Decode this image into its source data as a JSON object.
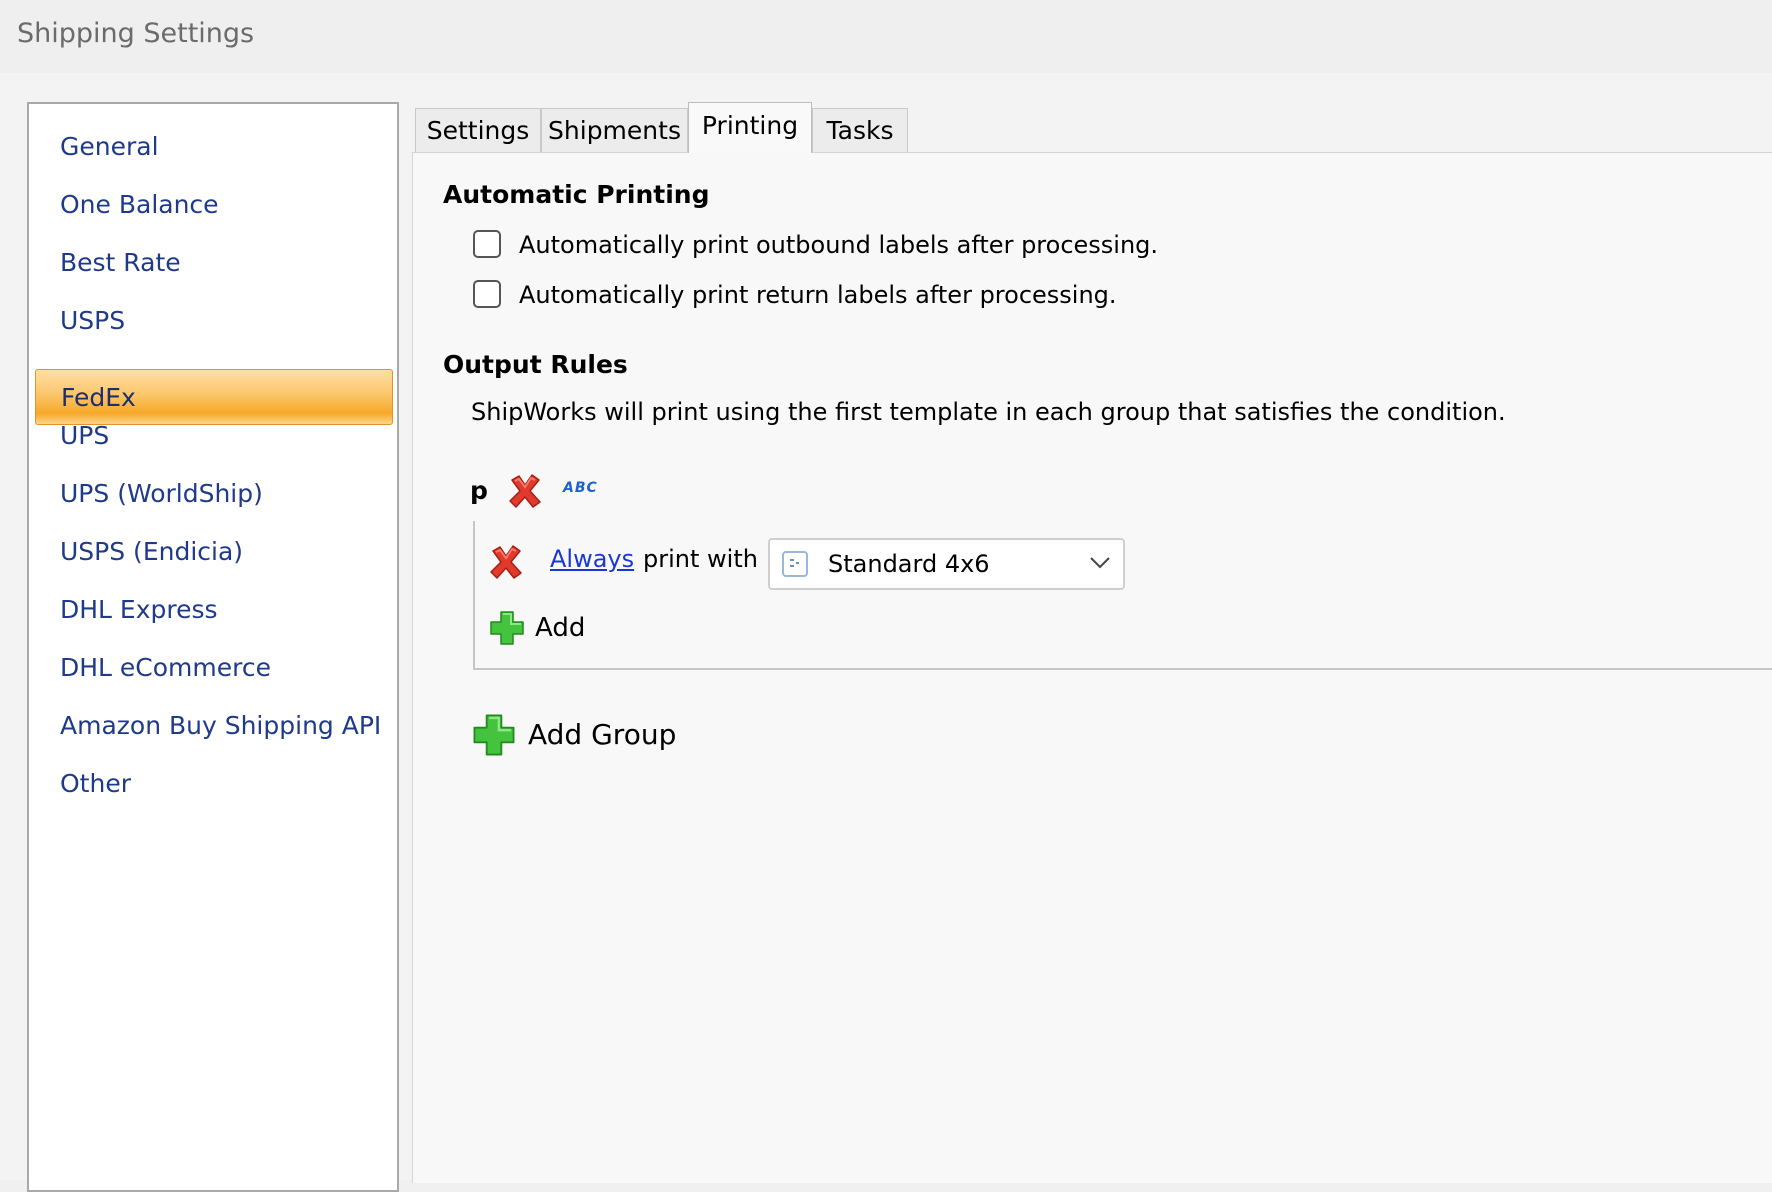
{
  "window": {
    "title": "Shipping Settings"
  },
  "sidebar": {
    "items": [
      {
        "label": "General"
      },
      {
        "label": "One Balance"
      },
      {
        "label": "Best Rate"
      },
      {
        "label": "USPS"
      },
      {
        "label": "FedEx"
      },
      {
        "label": "UPS"
      },
      {
        "label": "UPS (WorldShip)"
      },
      {
        "label": "USPS (Endicia)"
      },
      {
        "label": "DHL Express"
      },
      {
        "label": "DHL eCommerce"
      },
      {
        "label": "Amazon Buy Shipping API"
      },
      {
        "label": "Other"
      }
    ],
    "selected": "FedEx",
    "accent_color": "#f7a928"
  },
  "tabs": [
    {
      "label": "Settings"
    },
    {
      "label": "Shipments"
    },
    {
      "label": "Printing"
    },
    {
      "label": "Tasks"
    }
  ],
  "active_tab": "Printing",
  "automatic_printing": {
    "title": "Automatic Printing",
    "outbound_label": "Automatically print outbound labels after processing.",
    "outbound_checked": false,
    "return_label": "Automatically print return labels after processing.",
    "return_checked": false
  },
  "output_rules": {
    "title": "Output Rules",
    "description": "ShipWorks will print using the first template in each group that satisfies the condition.",
    "group": {
      "name": "p",
      "rename_icon": "ABC",
      "rule": {
        "condition_link": "Always",
        "text": "print with",
        "template": "Standard 4x6"
      },
      "add_label": "Add"
    },
    "add_group_label": "Add Group"
  },
  "icons": {
    "delete": "red-x-icon",
    "add": "green-plus-icon",
    "rename": "abc-rename-icon",
    "template": "template-doc-icon",
    "dropdown": "chevron-down-icon"
  },
  "colors": {
    "link": "#1a37d6",
    "nav_text": "#1f3a8a",
    "delete_red": "#e03a2c",
    "add_green": "#3fbf3a"
  }
}
